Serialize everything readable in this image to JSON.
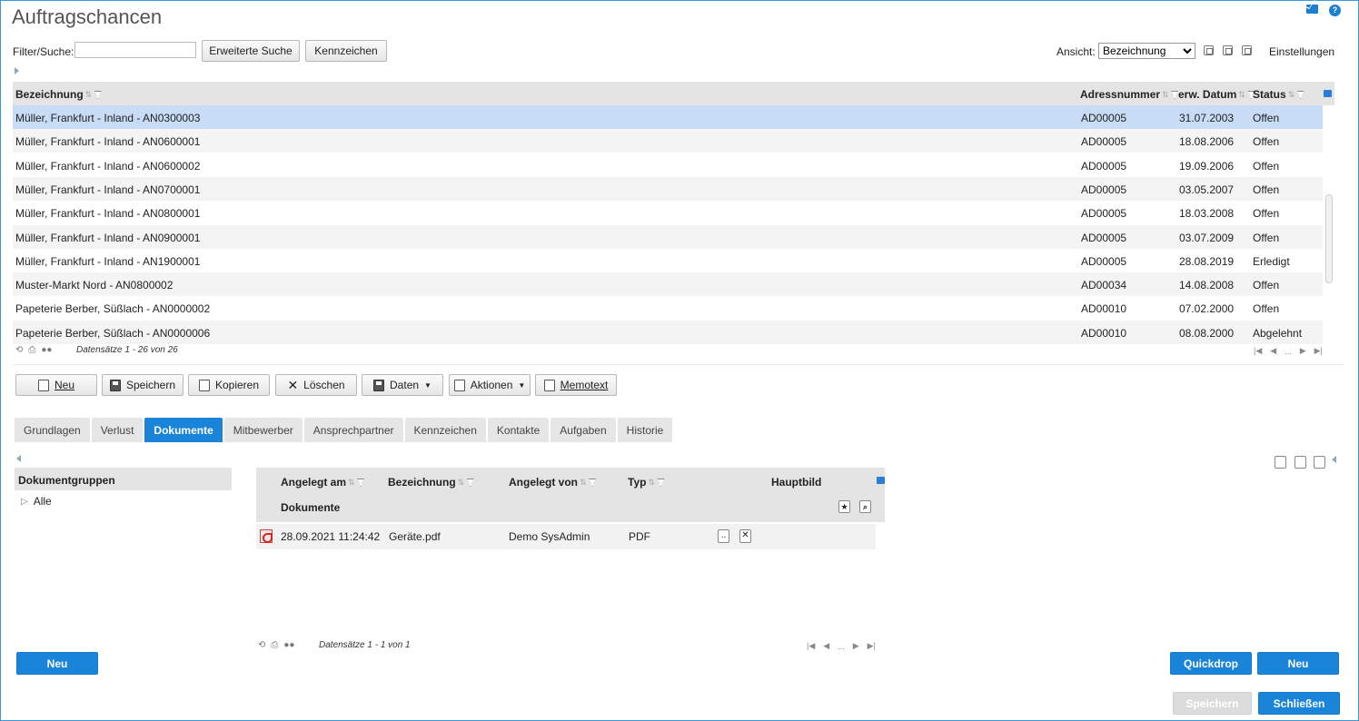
{
  "page": {
    "title": "Auftragschancen"
  },
  "toolbar": {
    "filter_label": "Filter/Suche:",
    "filter_value": "",
    "advanced_search": "Erweiterte Suche",
    "tags": "Kennzeichen",
    "view_label": "Ansicht:",
    "view_value": "Bezeichnung",
    "settings": "Einstellungen"
  },
  "grid": {
    "columns": [
      "Bezeichnung",
      "Adressnummer",
      "erw. Datum",
      "Status"
    ],
    "rows": [
      {
        "bez": "Müller, Frankfurt - Inland - AN0300003",
        "adr": "AD00005",
        "datum": "31.07.2003",
        "status": "Offen"
      },
      {
        "bez": "Müller, Frankfurt - Inland - AN0600001",
        "adr": "AD00005",
        "datum": "18.08.2006",
        "status": "Offen"
      },
      {
        "bez": "Müller, Frankfurt - Inland - AN0600002",
        "adr": "AD00005",
        "datum": "19.09.2006",
        "status": "Offen"
      },
      {
        "bez": "Müller, Frankfurt - Inland - AN0700001",
        "adr": "AD00005",
        "datum": "03.05.2007",
        "status": "Offen"
      },
      {
        "bez": "Müller, Frankfurt - Inland - AN0800001",
        "adr": "AD00005",
        "datum": "18.03.2008",
        "status": "Offen"
      },
      {
        "bez": "Müller, Frankfurt - Inland - AN0900001",
        "adr": "AD00005",
        "datum": "03.07.2009",
        "status": "Offen"
      },
      {
        "bez": "Müller, Frankfurt - Inland - AN1900001",
        "adr": "AD00005",
        "datum": "28.08.2019",
        "status": "Erledigt"
      },
      {
        "bez": "Muster-Markt Nord - AN0800002",
        "adr": "AD00034",
        "datum": "14.08.2008",
        "status": "Offen"
      },
      {
        "bez": "Papeterie Berber, Süßlach - AN0000002",
        "adr": "AD00010",
        "datum": "07.02.2000",
        "status": "Offen"
      },
      {
        "bez": "Papeterie Berber, Süßlach - AN0000006",
        "adr": "AD00010",
        "datum": "08.08.2000",
        "status": "Abgelehnt"
      }
    ],
    "records": "Datensätze 1 - 26 von 26",
    "pager_dots": "..."
  },
  "actions": {
    "new": "Neu",
    "save": "Speichern",
    "copy": "Kopieren",
    "delete": "Löschen",
    "data": "Daten",
    "actions": "Aktionen",
    "memo": "Memotext"
  },
  "tabs": [
    "Grundlagen",
    "Verlust",
    "Dokumente",
    "Mitbewerber",
    "Ansprechpartner",
    "Kennzeichen",
    "Kontakte",
    "Aufgaben",
    "Historie"
  ],
  "documents": {
    "group_header": "Dokumentgruppen",
    "group_all": "Alle",
    "columns": [
      "Angelegt am",
      "Bezeichnung",
      "Angelegt von",
      "Typ",
      "Hauptbild"
    ],
    "subheader": "Dokumente",
    "rows": [
      {
        "date": "28.09.2021 11:24:42",
        "name": "Geräte.pdf",
        "by": "Demo SysAdmin",
        "type": "PDF"
      }
    ],
    "records": "Datensätze 1 - 1 von 1",
    "pager_dots": "...",
    "new": "Neu",
    "quickdrop": "Quickdrop",
    "new_right": "Neu"
  },
  "footer": {
    "save": "Speichern",
    "close": "Schließen"
  }
}
